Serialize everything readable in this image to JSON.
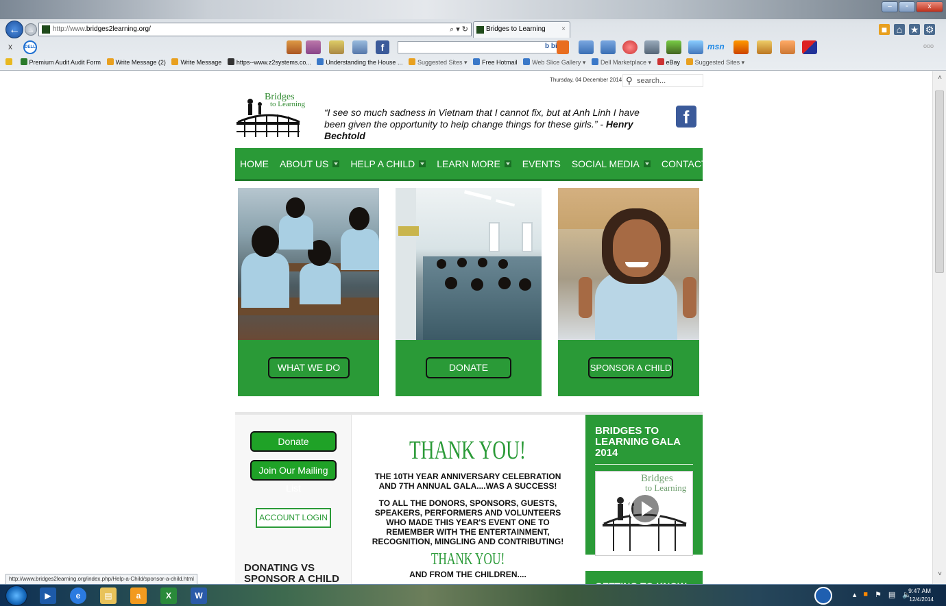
{
  "browser": {
    "address_prefix": "http://www.",
    "address_host": "bridges2learning.org/",
    "address_tools": "⌕ ▾ ↻",
    "tab_title": "Bridges to Learning",
    "tab_close": "×",
    "window_buttons": [
      "‒",
      "▫",
      "x"
    ],
    "commandbar_close": "x",
    "dell_label": "DELL",
    "bing_label": "b bing",
    "msn_label": "msn",
    "cmd_ellipsis": "ooo",
    "favorites": [
      "Premium Audit Audit Form",
      "Write Message (2)",
      "Write Message",
      "https--www.z2systems.co...",
      "Understanding the House ...",
      "Suggested Sites ▾",
      "Free Hotmail",
      "Web Slice Gallery ▾",
      "Dell Marketplace ▾",
      "eBay",
      "Suggested Sites ▾"
    ],
    "status_url": "http://www.bridges2learning.org/index.php/Help-a-Child/sponsor-a-child.html"
  },
  "header": {
    "date": "Thursday, 04 December 2014",
    "search_placeholder": "search...",
    "logo_line1": "Bridges",
    "logo_line2": "to Learning",
    "quote": "“I see so much sadness in Vietnam that I cannot fix, but at Anh Linh I have been given the opportunity to help change things for these girls.” - ",
    "quote_author": "Henry Bechtold",
    "facebook": "f"
  },
  "nav": [
    {
      "label": "HOME",
      "has_menu": false
    },
    {
      "label": "ABOUT US",
      "has_menu": true
    },
    {
      "label": "HELP A CHILD",
      "has_menu": true
    },
    {
      "label": "LEARN MORE",
      "has_menu": true
    },
    {
      "label": "EVENTS",
      "has_menu": false
    },
    {
      "label": "SOCIAL MEDIA",
      "has_menu": true
    },
    {
      "label": "CONTACT US",
      "has_menu": false
    }
  ],
  "features": [
    {
      "button": "WHAT WE DO"
    },
    {
      "button": "DONATE"
    },
    {
      "button": "SPONSOR A CHILD"
    }
  ],
  "left_col": {
    "donate": "Donate",
    "mailing": "Join Our Mailing List",
    "login": "ACCOUNT LOGIN",
    "donating_title": "DONATING VS SPONSOR A CHILD"
  },
  "center": {
    "thank_you": "THANK YOU!",
    "para1": "THE 10TH YEAR ANNIVERSARY CELEBRATION AND 7TH ANNUAL GALA....WAS A SUCCESS!",
    "para2": "TO ALL THE DONORS, SPONSORS, GUESTS, SPEAKERS, PERFORMERS AND VOLUNTEERS WHO MADE THIS YEAR'S EVENT ONE TO REMEMBER WITH THE ENTERTAINMENT, RECOGNITION, MINGLING AND CONTRIBUTING!",
    "thank_you_2": "THANK YOU!",
    "para3": "AND FROM THE CHILDREN...."
  },
  "right_col": {
    "gala_title": "BRIDGES TO LEARNING GALA 2014",
    "video_logo_1": "Bridges",
    "video_logo_2": "to Learning",
    "getting_title": "GETTING TO KNOW"
  },
  "scroll": {
    "up": "˄",
    "down": "˅"
  },
  "taskbar": {
    "time": "9:47 AM",
    "date": "12/4/2014",
    "amazon": "a",
    "word": "W"
  },
  "colors": {
    "brand_green": "#2a9a37",
    "button_green": "#1fa227",
    "facebook_blue": "#3b5a9a"
  }
}
